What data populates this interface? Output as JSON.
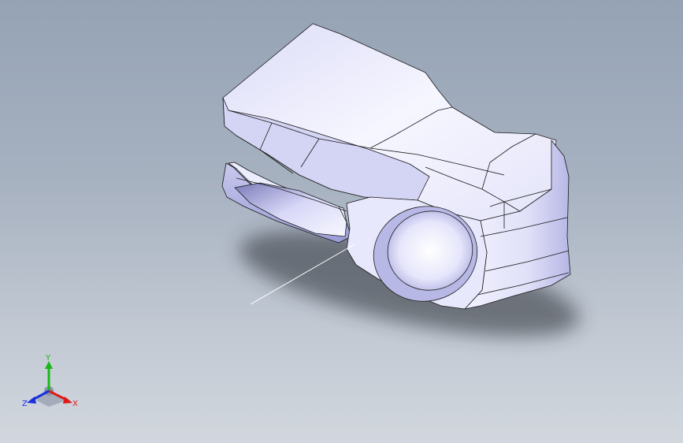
{
  "viewport": {
    "background_top": "#95a3b5",
    "background_bottom": "#d2d7de"
  },
  "model": {
    "shading_light": "#f4f4ff",
    "shading_mid": "#c9c9ee",
    "shading_dark": "#9a9ad6",
    "edge_color": "#1a1a1a"
  },
  "triad": {
    "x_label": "X",
    "y_label": "Y",
    "z_label": "Z",
    "x_color": "#e01818",
    "y_color": "#18b818",
    "z_color": "#1830e0"
  }
}
